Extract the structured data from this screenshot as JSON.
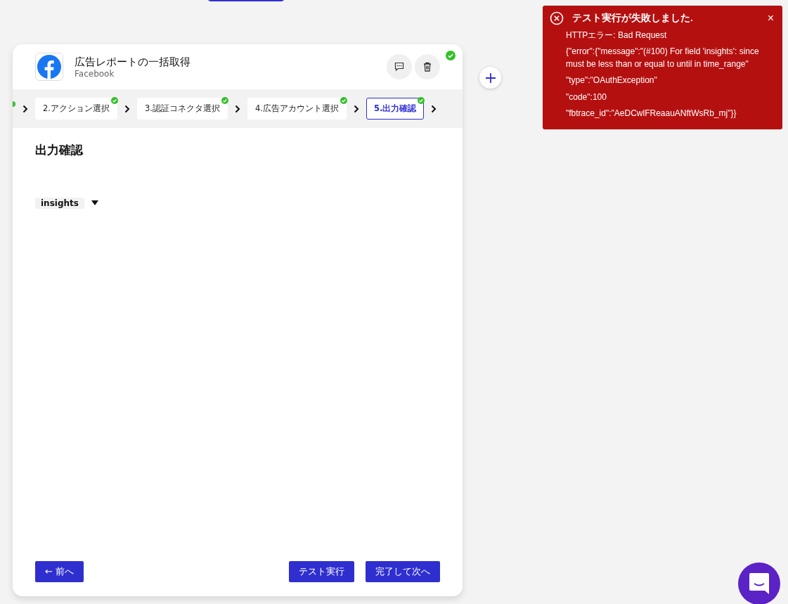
{
  "node": {
    "title": "広告レポートの一括取得",
    "subtitle": "Facebook",
    "done": true
  },
  "steps": [
    {
      "label": "2.アクション選択",
      "done": true,
      "selected": false
    },
    {
      "label": "3.認証コネクタ選択",
      "done": true,
      "selected": false
    },
    {
      "label": "4.広告アカウント選択",
      "done": true,
      "selected": false
    },
    {
      "label": "5.出力確認",
      "done": true,
      "selected": true
    }
  ],
  "section_title": "出力確認",
  "output": {
    "label": "insights",
    "expanded": false
  },
  "buttons": {
    "back": "← 前へ",
    "test": "テスト実行",
    "next": "完了して次へ"
  },
  "toast": {
    "title": "テスト実行が失敗しました.",
    "close": "×",
    "lines": [
      "HTTPエラー: Bad Request",
      "{\"error\":{\"message\":\"(#100) For field 'insights': since must be less than or equal to until in time_range\"",
      "\"type\":\"OAuthException\"",
      "\"code\":100",
      "\"fbtrace_id\":\"AeDCwlFReaauANftWsRb_mj\"}}"
    ]
  }
}
